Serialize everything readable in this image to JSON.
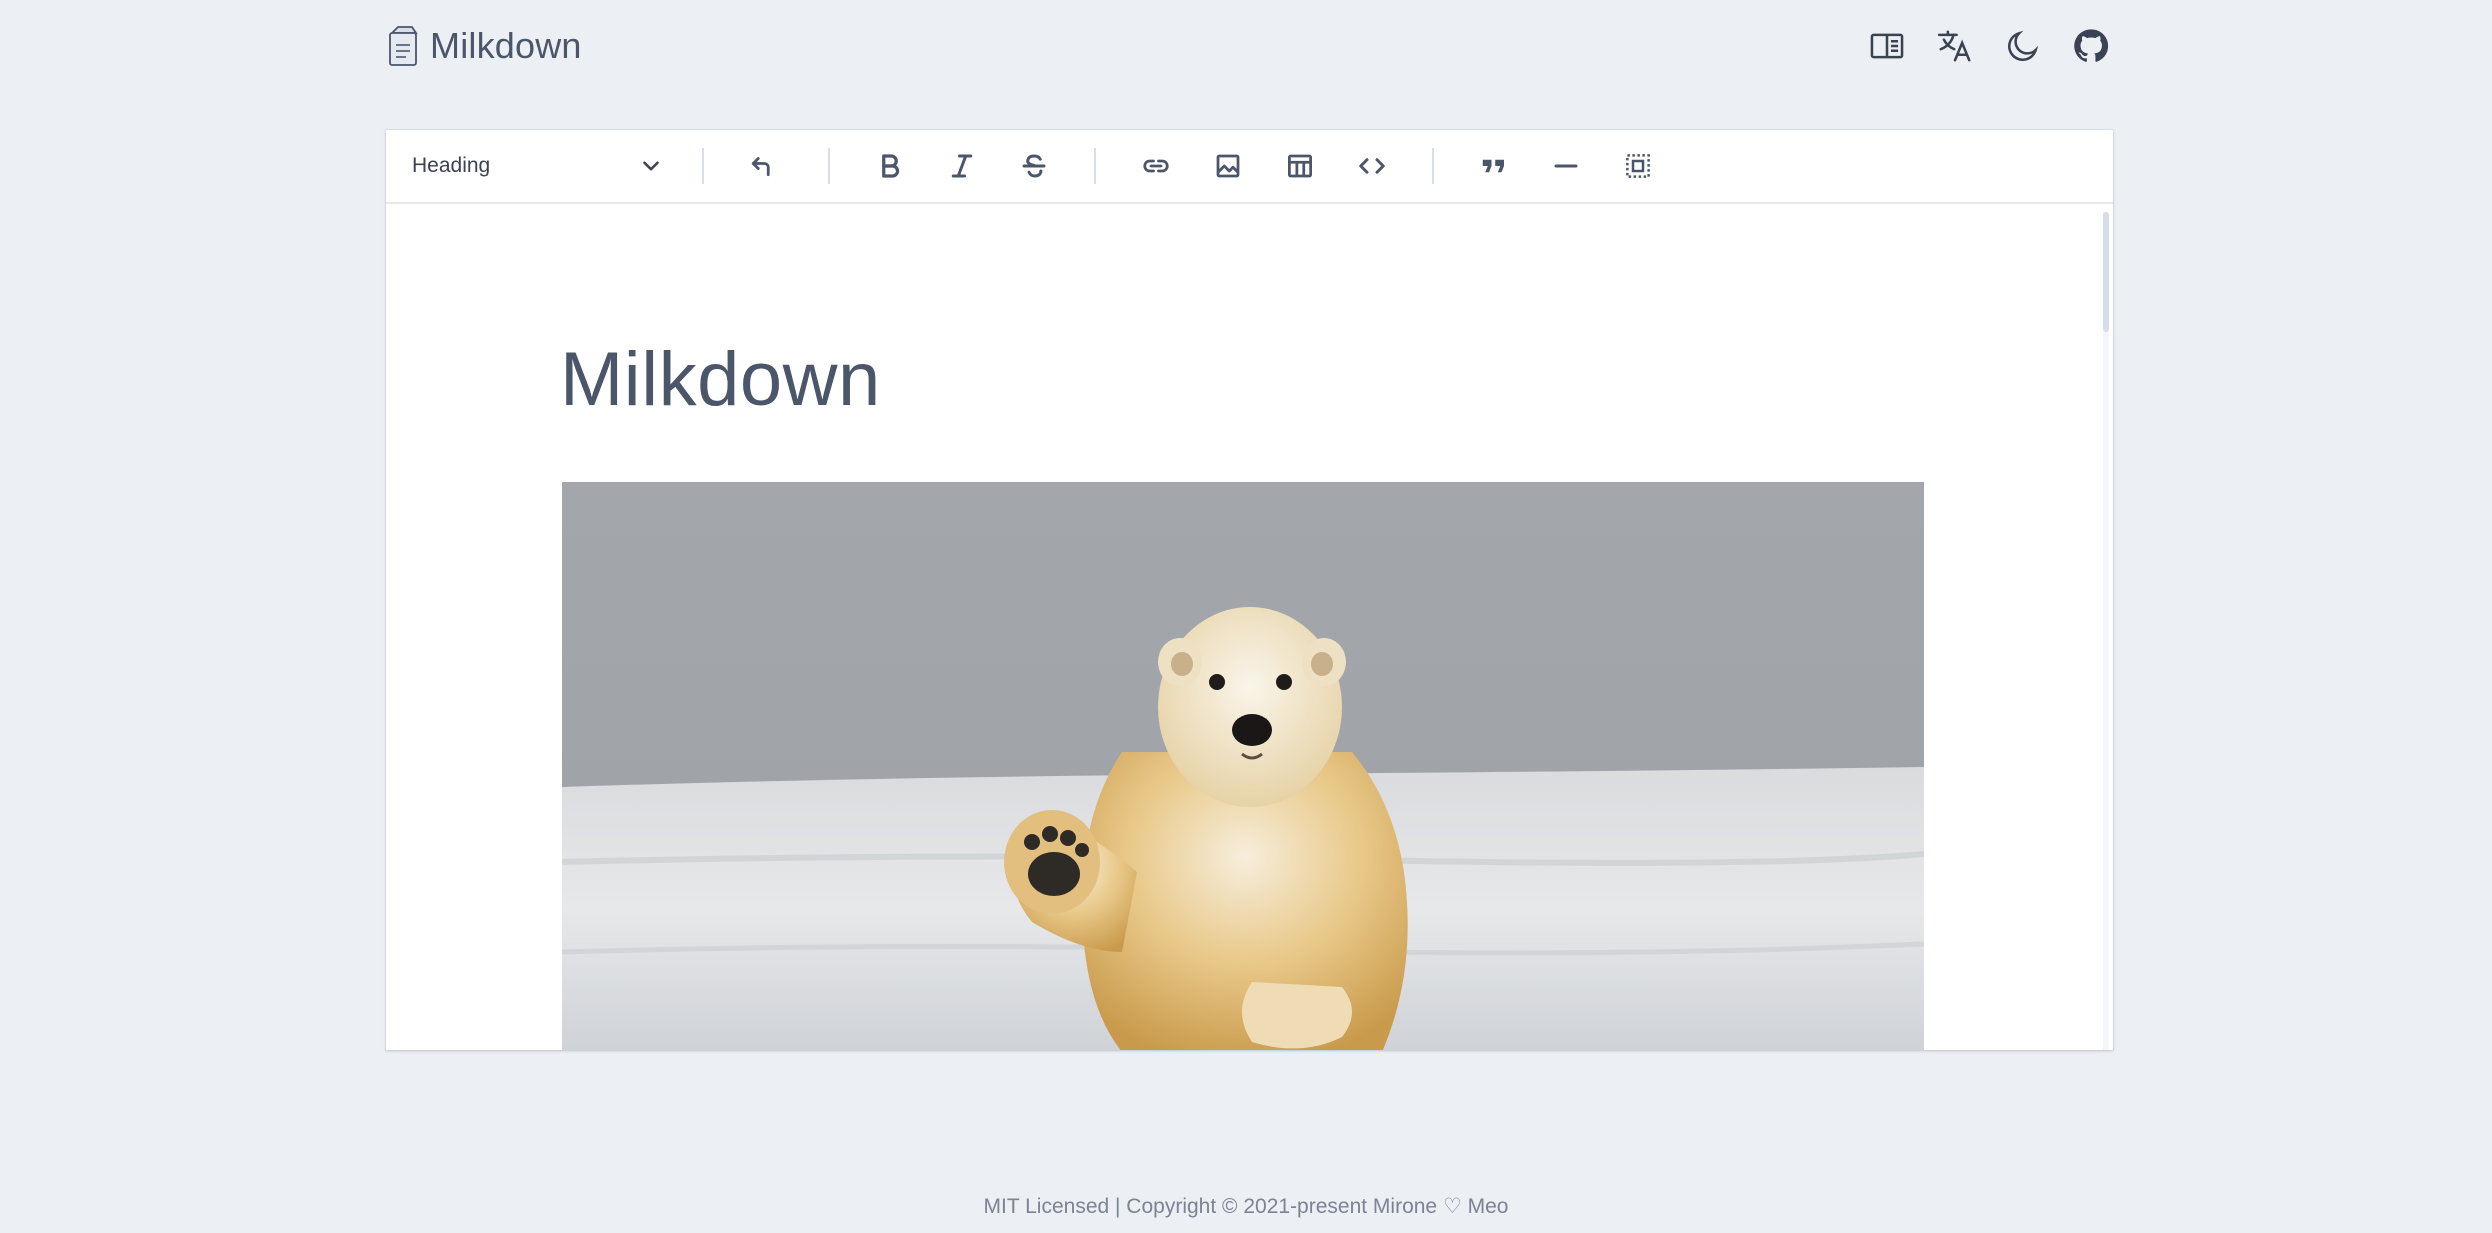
{
  "header": {
    "brand": "Milkdown",
    "icons": [
      "book-icon",
      "translate-icon",
      "moon-icon",
      "github-icon"
    ]
  },
  "toolbar": {
    "heading_select": "Heading",
    "buttons": [
      "undo",
      "bold",
      "italic",
      "strikethrough",
      "link",
      "image",
      "table",
      "code",
      "quote",
      "divider",
      "select-all"
    ]
  },
  "document": {
    "title": "Milkdown"
  },
  "footer": {
    "text": "MIT Licensed | Copyright © 2021-present Mirone ♡ Meo"
  },
  "colors": {
    "background": "#eceff4",
    "text": "#4c566a",
    "card": "#ffffff"
  }
}
